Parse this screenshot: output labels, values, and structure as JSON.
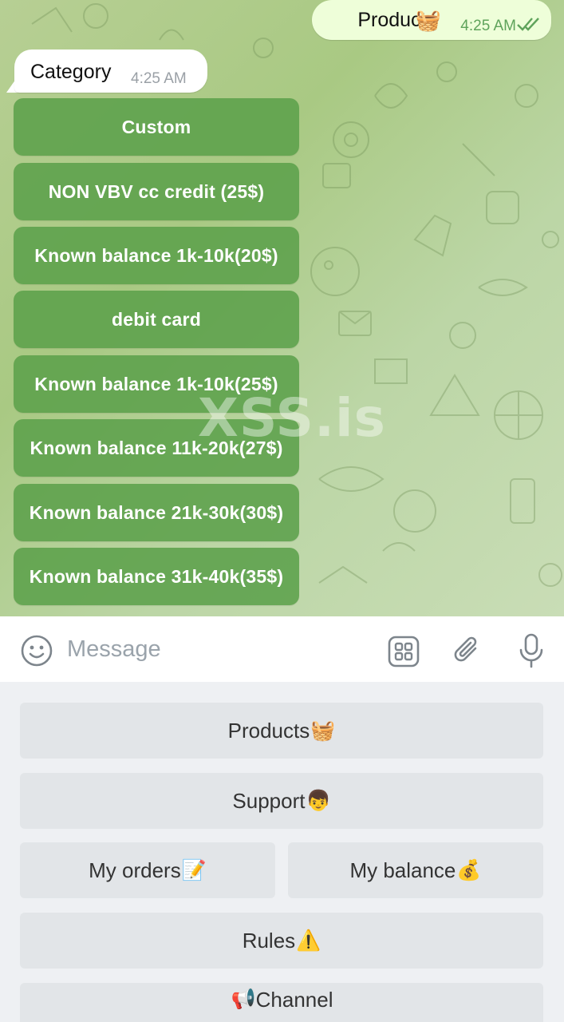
{
  "chat": {
    "outgoing": {
      "text": "Products",
      "emoji": "🧺",
      "time": "4:25 AM"
    },
    "incoming": {
      "text": "Category",
      "time": "4:25 AM"
    },
    "inline_buttons": [
      "Custom",
      "NON VBV cc credit (25$)",
      "Known balance 1k-10k(20$)",
      "debit card",
      "Known balance 1k-10k(25$)",
      "Known balance 11k-20k(27$)",
      "Known balance 21k-30k(30$)",
      "Known balance 31k-40k(35$)"
    ],
    "watermark": "XSS.is"
  },
  "input": {
    "placeholder": "Message"
  },
  "keyboard": {
    "products": {
      "label": "Products",
      "emoji": "🧺"
    },
    "support": {
      "label": "Support",
      "emoji": "👦"
    },
    "my_orders": {
      "label": "My orders",
      "emoji": "📝"
    },
    "my_balance": {
      "label": "My balance",
      "emoji": "💰"
    },
    "rules": {
      "label": "Rules",
      "emoji": "⚠️"
    },
    "channel": {
      "label": "Channel",
      "emoji": "📢"
    }
  },
  "colors": {
    "inline_button": "#5ca04b",
    "outgoing_bubble": "#eefed9",
    "time_outgoing": "#5fa35b",
    "keyboard_button": "#e2e5e8"
  }
}
